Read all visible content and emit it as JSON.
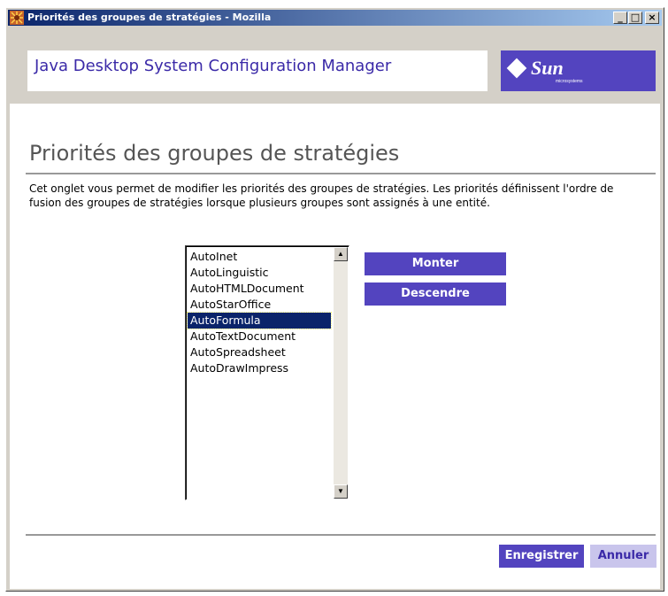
{
  "window": {
    "title": "Priorités des groupes de stratégies - Mozilla",
    "controls": {
      "minimize": "_",
      "maximize": "□",
      "close": "×"
    },
    "app_icon": "mozilla-icon"
  },
  "masthead": {
    "app_name": "Java Desktop System Configuration Manager",
    "logo_text": "Sun",
    "logo_subtext": "microsystems",
    "brand_color": "#5344bf"
  },
  "page": {
    "title": "Priorités des groupes de stratégies",
    "description": "Cet onglet vous permet de modifier les priorités des groupes de stratégies. Les priorités définissent l'ordre de fusion des groupes de stratégies lorsque plusieurs groupes sont assignés à une entité."
  },
  "policy_list": {
    "items": [
      {
        "label": "AutoInet",
        "selected": false
      },
      {
        "label": "AutoLinguistic",
        "selected": false
      },
      {
        "label": "AutoHTMLDocument",
        "selected": false
      },
      {
        "label": "AutoStarOffice",
        "selected": false
      },
      {
        "label": "AutoFormula",
        "selected": true
      },
      {
        "label": "AutoTextDocument",
        "selected": false
      },
      {
        "label": "AutoSpreadsheet",
        "selected": false
      },
      {
        "label": "AutoDrawImpress",
        "selected": false
      }
    ],
    "scroll_up": "▲",
    "scroll_down": "▼"
  },
  "actions": {
    "move_up": "Monter",
    "move_down": "Descendre"
  },
  "footer": {
    "save": "Enregistrer",
    "cancel": "Annuler"
  }
}
